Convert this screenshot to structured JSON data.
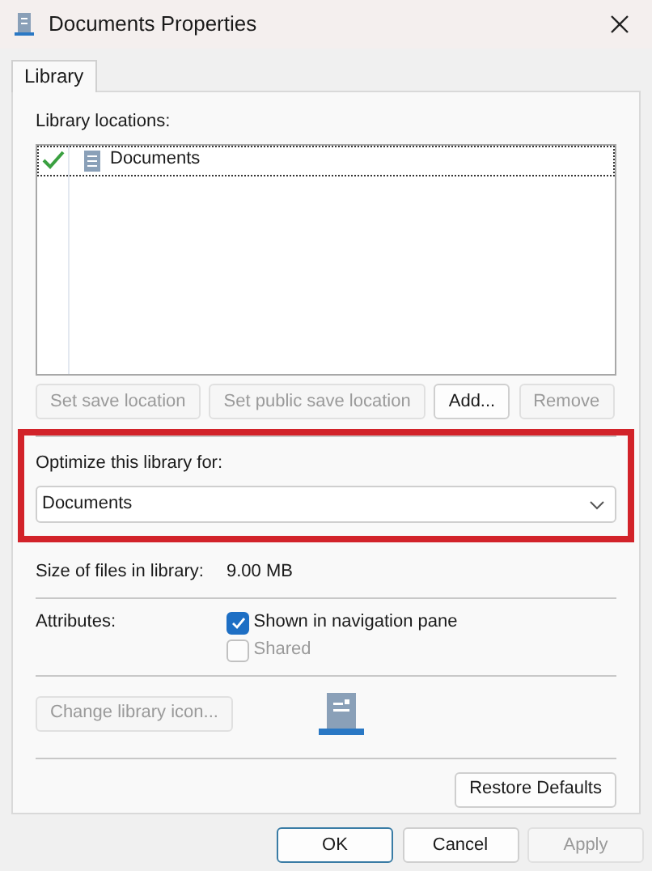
{
  "window": {
    "title": "Documents Properties"
  },
  "tabs": [
    {
      "label": "Library",
      "selected": true
    }
  ],
  "locations_label": "Library locations:",
  "locations": [
    {
      "name": "Documents",
      "default_save": true,
      "selected": true
    }
  ],
  "location_buttons": [
    {
      "label": "Set save location",
      "disabled": true
    },
    {
      "label": "Set public save location",
      "disabled": true
    },
    {
      "label": "Add...",
      "disabled": false
    },
    {
      "label": "Remove",
      "disabled": true
    }
  ],
  "optimize": {
    "label": "Optimize this library for:",
    "value": "Documents",
    "highlighted": true
  },
  "size": {
    "label": "Size of files in library:",
    "value": "9.00 MB"
  },
  "attributes": {
    "label": "Attributes:",
    "options": [
      {
        "label": "Shown in navigation pane",
        "checked": true,
        "disabled": false
      },
      {
        "label": "Shared",
        "checked": false,
        "disabled": true
      }
    ]
  },
  "change_icon_button": {
    "label": "Change library icon...",
    "disabled": true
  },
  "restore_button": {
    "label": "Restore Defaults"
  },
  "dialog_buttons": [
    {
      "label": "OK",
      "default": true,
      "disabled": false
    },
    {
      "label": "Cancel",
      "default": false,
      "disabled": false
    },
    {
      "label": "Apply",
      "default": false,
      "disabled": true
    }
  ]
}
